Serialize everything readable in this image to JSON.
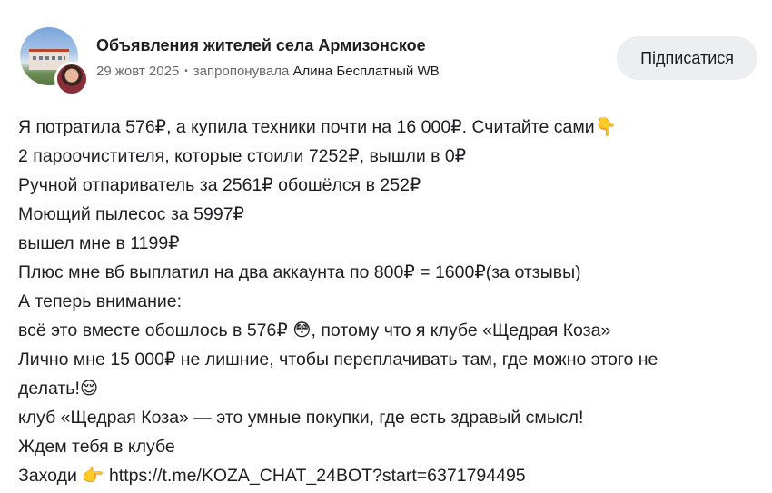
{
  "header": {
    "group_name": "Объявления жителей села Армизонское",
    "date": "29 жовт 2025",
    "dot": "•",
    "suggested_by_label": "запропонувала",
    "author": "Алина Бесплатный WB",
    "subscribe_label": "Підписатися"
  },
  "post": {
    "lines": [
      {
        "text": "Я потратила 576₽, а купила техники почти на 16 000₽. Считайте сами",
        "emoji": "👇"
      },
      {
        "text": "2 пароочистителя, которые стоили 7252₽, вышли в 0₽"
      },
      {
        "text": "Ручной отпариватель за 2561₽ обошёлся в 252₽"
      },
      {
        "text": "Моющий пылесос за 5997₽"
      },
      {
        "text": "вышел мне в 1199₽"
      },
      {
        "text": "Плюс мне вб выплатил на два аккаунта по 800₽ = 1600₽(за отзывы)"
      },
      {
        "text": "А теперь внимание:"
      },
      {
        "text": "всё это вместе обошлось в 576₽ ",
        "emoji": "😳",
        "after": ", потому что я клубе «Щедрая Коза»"
      },
      {
        "text": "Лично мне 15 000₽ не лишние, чтобы переплачивать там, где можно этого не"
      },
      {
        "text": "делать!",
        "emoji": "😌"
      },
      {
        "text": "клуб «Щедрая Коза» — это умные покупки, где есть здравый смысл!"
      },
      {
        "text": "Ждем тебя в клубе"
      },
      {
        "text": "Заходи ",
        "emoji": "👉",
        "after": " https://t.me/KOZA_CHAT_24BOT?start=6371794495"
      }
    ]
  }
}
